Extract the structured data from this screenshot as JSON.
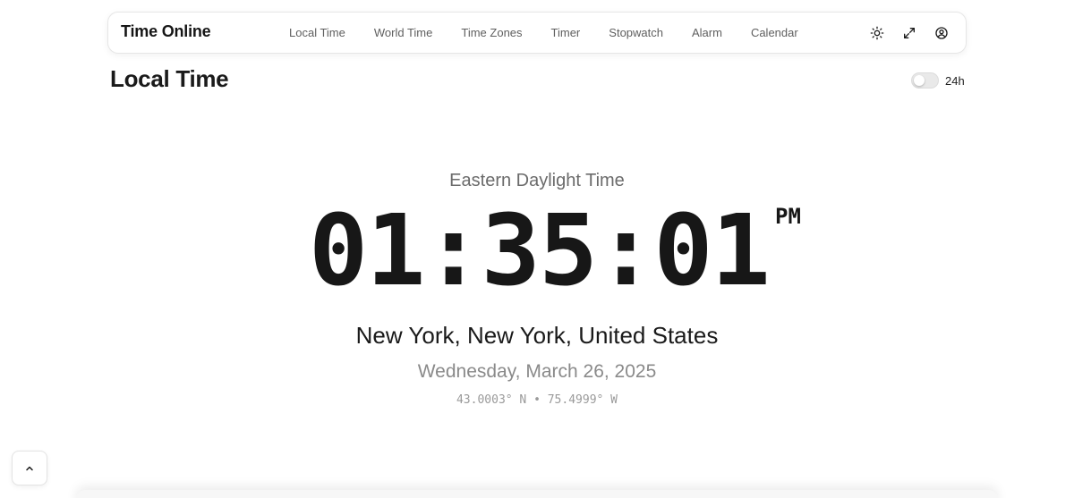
{
  "header": {
    "brand": "Time Online",
    "nav": [
      {
        "label": "Local Time"
      },
      {
        "label": "World Time"
      },
      {
        "label": "Time Zones"
      },
      {
        "label": "Timer"
      },
      {
        "label": "Stopwatch"
      },
      {
        "label": "Alarm"
      },
      {
        "label": "Calendar"
      }
    ],
    "actions": [
      {
        "icon": "sun-icon"
      },
      {
        "icon": "expand-icon"
      },
      {
        "icon": "user-circle-icon"
      }
    ]
  },
  "page": {
    "title": "Local Time",
    "toggle": {
      "label": "24h",
      "checked": false
    }
  },
  "clock": {
    "timezone_name": "Eastern Daylight Time",
    "time": "01:35:01",
    "period": "PM",
    "location": "New York, New York, United States",
    "date": "Wednesday, March 26, 2025",
    "coordinates": "43.0003° N • 75.4999° W"
  },
  "footer": {
    "back_to_top_icon": "chevron-up-icon"
  },
  "colors": {
    "text_primary": "#1a1a1a",
    "text_muted": "#8a8a8a",
    "nav_text": "#5f5f5f",
    "border": "#e6e6e6"
  }
}
